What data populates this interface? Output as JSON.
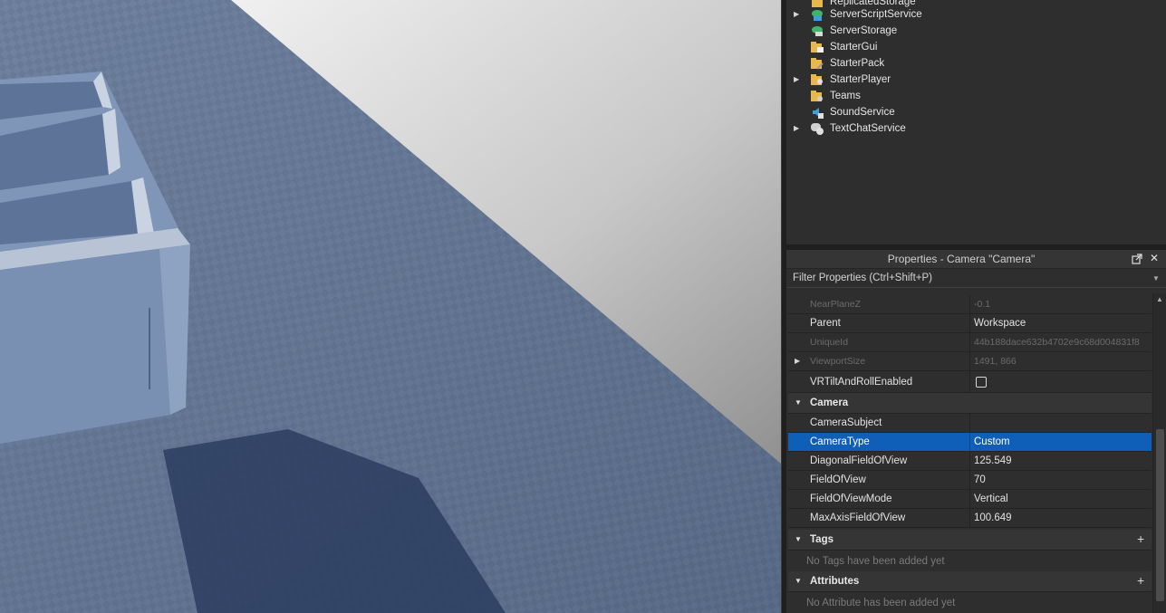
{
  "explorer": {
    "items": [
      {
        "label": "ReplicatedStorage",
        "expandable": false,
        "icon": "replicated-storage-icon"
      },
      {
        "label": "ServerScriptService",
        "expandable": true,
        "icon": "server-script-service-icon"
      },
      {
        "label": "ServerStorage",
        "expandable": false,
        "icon": "server-storage-icon"
      },
      {
        "label": "StarterGui",
        "expandable": false,
        "icon": "starter-gui-icon"
      },
      {
        "label": "StarterPack",
        "expandable": false,
        "icon": "starter-pack-icon"
      },
      {
        "label": "StarterPlayer",
        "expandable": true,
        "icon": "starter-player-icon"
      },
      {
        "label": "Teams",
        "expandable": false,
        "icon": "teams-icon"
      },
      {
        "label": "SoundService",
        "expandable": false,
        "icon": "sound-service-icon"
      },
      {
        "label": "TextChatService",
        "expandable": true,
        "icon": "text-chat-service-icon"
      }
    ]
  },
  "properties": {
    "title": "Properties - Camera \"Camera\"",
    "filter_placeholder": "Filter Properties (Ctrl+Shift+P)",
    "rows": [
      {
        "kind": "prop",
        "name": "NearPlaneZ",
        "value": "-0.1",
        "disabled": true
      },
      {
        "kind": "prop",
        "name": "Parent",
        "value": "Workspace"
      },
      {
        "kind": "prop",
        "name": "UniqueId",
        "value": "44b188dace632b4702e9c68d004831f8",
        "disabled": true
      },
      {
        "kind": "prop",
        "name": "ViewportSize",
        "value": "1491, 866",
        "disabled": true,
        "expandable": true
      },
      {
        "kind": "prop",
        "name": "VRTiltAndRollEnabled",
        "value": "",
        "checkbox": true,
        "checked": false
      },
      {
        "kind": "category",
        "name": "Camera"
      },
      {
        "kind": "prop",
        "name": "CameraSubject",
        "value": ""
      },
      {
        "kind": "prop",
        "name": "CameraType",
        "value": "Custom",
        "selected": true
      },
      {
        "kind": "prop",
        "name": "DiagonalFieldOfView",
        "value": "125.549"
      },
      {
        "kind": "prop",
        "name": "FieldOfView",
        "value": "70"
      },
      {
        "kind": "prop",
        "name": "FieldOfViewMode",
        "value": "Vertical"
      },
      {
        "kind": "prop",
        "name": "MaxAxisFieldOfView",
        "value": "100.649"
      },
      {
        "kind": "category",
        "name": "Tags",
        "add": true
      },
      {
        "kind": "empty",
        "text": "No Tags have been added yet"
      },
      {
        "kind": "category",
        "name": "Attributes",
        "add": true
      },
      {
        "kind": "empty",
        "text": "No Attribute has been added yet"
      }
    ]
  },
  "colors": {
    "selection": "#0f5fb8",
    "panel_bg": "#2e2e2e",
    "baseplate": "#5e708a",
    "wall": "#7f95b5"
  }
}
